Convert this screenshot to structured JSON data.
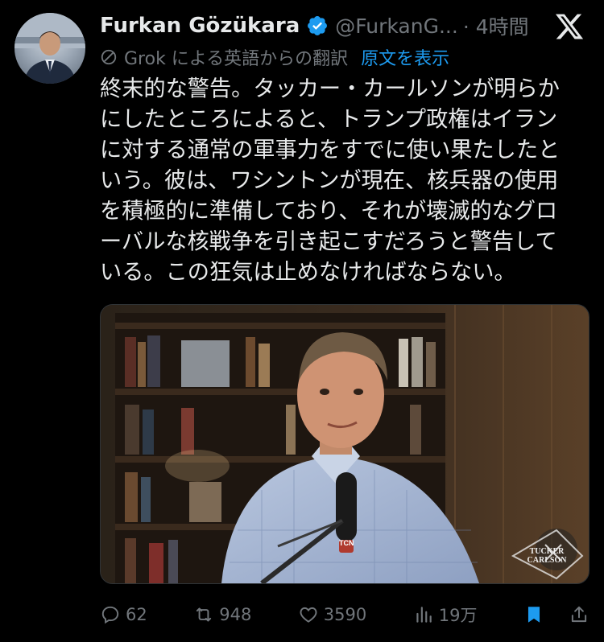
{
  "author": {
    "name": "Furkan Gözükara",
    "handle": "@FurkanG...",
    "time": "· 4時間",
    "verified": true
  },
  "translation": {
    "source_label": "Grok による英語からの翻訳",
    "show_original": "原文を表示"
  },
  "post": {
    "lines": [
      "終末的な警告。タッカー・カールソンが明らか",
      "にしたところによると、トランプ政権はイラン",
      "に対する通常の軍事力をすでに使い果たしたと",
      "いう。彼は、ワシントンが現在、核兵器の使用",
      "を積極的に準備しており、それが壊滅的なグロ",
      "ーバルな核戦争を引き起こすだろうと警告して",
      "いる。この狂気は止めなければならない。"
    ]
  },
  "media": {
    "mic_badge": "TCN",
    "watermark_line1": "TUCKER",
    "watermark_line2": "CARLSON"
  },
  "actions": {
    "replies": "62",
    "reposts": "948",
    "likes": "3590",
    "views": "19万"
  },
  "colors": {
    "accent": "#1d9bf0",
    "muted": "#71767b",
    "text": "#e7e9ea",
    "background": "#000000"
  },
  "icons": [
    "verified-badge-icon",
    "x-logo-icon",
    "translate-icon",
    "reply-icon",
    "repost-icon",
    "like-icon",
    "views-icon",
    "bookmark-icon",
    "share-icon"
  ]
}
